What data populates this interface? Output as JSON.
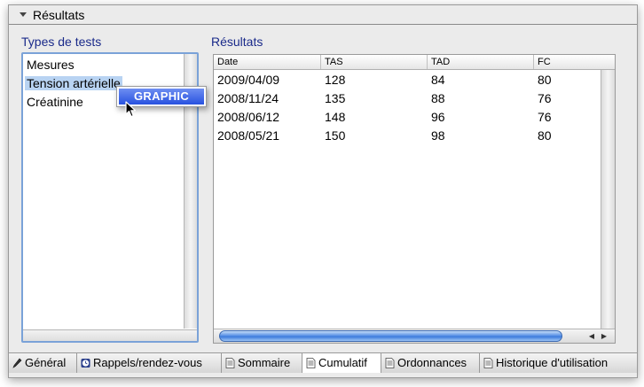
{
  "section": {
    "title": "Résultats"
  },
  "left_panel": {
    "label": "Types de tests",
    "items": [
      "Mesures",
      "Tension artérielle",
      "Créatinine"
    ],
    "selected_index": 1
  },
  "context_menu": {
    "item": "GRAPHIC"
  },
  "right_panel": {
    "label": "Résultats",
    "columns": [
      "Date",
      "TAS",
      "TAD",
      "FC"
    ],
    "rows": [
      [
        "2009/04/09",
        "128",
        "84",
        "80"
      ],
      [
        "2008/11/24",
        "135",
        "88",
        "76"
      ],
      [
        "2008/06/12",
        "148",
        "96",
        "76"
      ],
      [
        "2008/05/21",
        "150",
        "98",
        "80"
      ]
    ]
  },
  "tabs": [
    {
      "label": "Général",
      "icon": "pencil-icon",
      "active": false
    },
    {
      "label": "Rappels/rendez-vous",
      "icon": "clock-icon",
      "active": false
    },
    {
      "label": "Sommaire",
      "icon": "document-icon",
      "active": false
    },
    {
      "label": "Cumulatif",
      "icon": "document-icon",
      "active": true
    },
    {
      "label": "Ordonnances",
      "icon": "document-icon",
      "active": false
    },
    {
      "label": "Historique d'utilisation",
      "icon": "document-icon",
      "active": false
    }
  ],
  "colors": {
    "label_blue": "#1a2a8a",
    "selection": "#b8d3f2",
    "menu_highlight": "#2852e0"
  }
}
